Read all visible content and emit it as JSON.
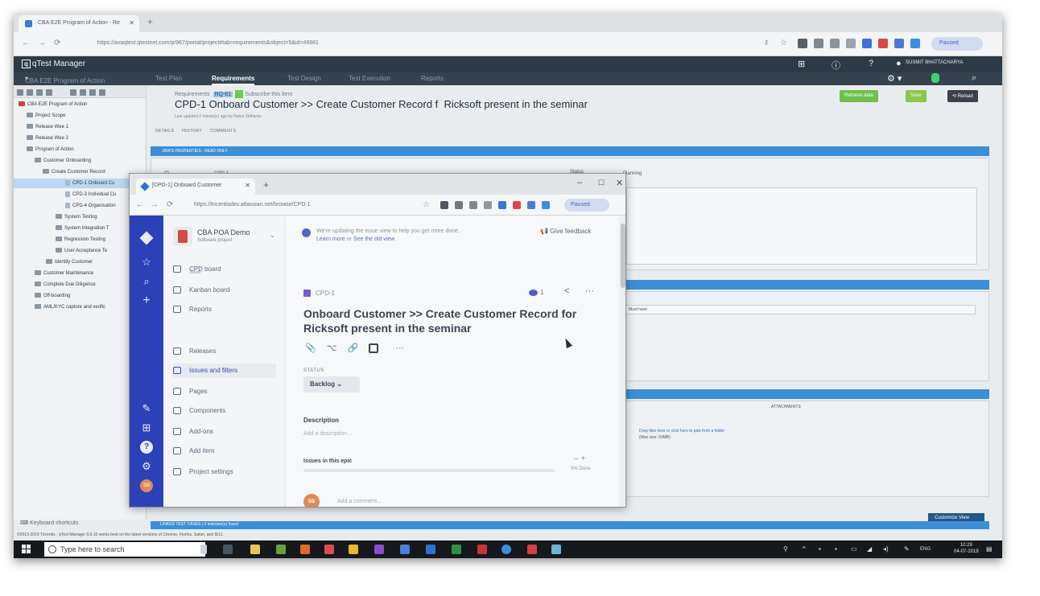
{
  "back_browser": {
    "tab_title": "CBA E2E Program of Action - Re",
    "url": "https://avaqtest.qtestnet.com/p/967/portal/project#tab=requirements&object=5&id=49981",
    "paused_label": "Paused"
  },
  "qtest": {
    "logo_text": "qTest Manager",
    "user_name": "SUSMIT BHATTACHARYA",
    "project_selector": "CBA E2E Program of Action",
    "nav_tabs": [
      "Test Plan",
      "Requirements",
      "Test Design",
      "Test Execution",
      "Reports"
    ],
    "tree": [
      "CBA E2E Program of Action",
      "Project Scope",
      "Release Wee 1",
      "Release Wee 2",
      "Program of Action",
      "Customer Onboarding",
      "Create Customer Record",
      "CPD-1 Onboard Cu",
      "CPD-3 Individual Cu",
      "CPD-4 Organisation",
      "System Testing",
      "System Integration T",
      "Regression Testing",
      "User Acceptance Te",
      "Identify Customer",
      "Customer Maintenance",
      "Complete Due Diligence",
      "Off-boarding",
      "AML/KYC capture and verific"
    ],
    "keyboard_shortcuts": "Keyboard shortcuts",
    "footnote": "©2013-2019 Tricentis · qTest Manager 9.6.10 works best on the latest versions of Chrome, Firefox, Safari, and IE11.",
    "breadcrumb": "Requirements",
    "req_id": "RQ-61",
    "subscribe_text": "Subscribe this item",
    "title": "CPD-1 Onboard Customer >> Create Customer Record f  Ricksoft present in the seminar",
    "last_updated": "Last updated 2 minute(s) ago by Rahul Sidhanta",
    "detail_tabs": [
      "DETAILS",
      "HISTORY",
      "COMMENTS"
    ],
    "buttons": {
      "retrieve": "Retrieve data",
      "save": "Save",
      "reload": "Reload"
    },
    "section_properties": "JIRA'S PROPERTIES - READ ONLY",
    "field_id": "ID",
    "field_id_value": "CPD-1",
    "field_status": "Status",
    "field_priority": "Planning",
    "select_value": "Must have",
    "attachments_label": "ATTACHMENTS",
    "drop_text": "Drag files here or click here to pick from a folder",
    "drop_size": "(Max size: 50MB)",
    "customize_view": "Customize View",
    "link_status": "LINKED TEST CASES | 0 testcase(s) found"
  },
  "jira_window": {
    "tab_title": "[CPD-1] Onboard Customer",
    "url": "https://tricentisdev.atlassian.net/browse/CPD-1",
    "paused_label": "Paused",
    "project_name": "CBA POA Demo",
    "project_type": "Software project",
    "sidebar": [
      {
        "label": "CPD board",
        "sub": "Board"
      },
      {
        "label": "Kanban board"
      },
      {
        "label": "Reports"
      },
      {
        "label": "Releases"
      },
      {
        "label": "Issues and filters"
      },
      {
        "label": "Pages"
      },
      {
        "label": "Components"
      },
      {
        "label": "Add-ons"
      },
      {
        "label": "Add item"
      },
      {
        "label": "Project settings"
      }
    ],
    "notice_line1": "We're updating the issue view to help you get more done.",
    "notice_learn": "Learn more",
    "notice_or": "or",
    "notice_old": "See the old view",
    "give_feedback": "Give feedback",
    "issue_key": "CPD-1",
    "watch_count": "1",
    "summary": "Onboard Customer >> Create Customer Record for Ricksoft present in the seminar",
    "status_label": "STATUS",
    "status_value": "Backlog",
    "description_heading": "Description",
    "description_placeholder": "Add a description...",
    "epic_heading": "Issues in this epic",
    "epic_progress_text": "0% Done",
    "epic_progress": 0,
    "avatar_initials": "SB",
    "comment_placeholder": "Add a comment..."
  },
  "taskbar": {
    "search_placeholder": "Type here to search",
    "language": "ENG",
    "time": "10:29",
    "date": "04-07-2019"
  },
  "colors": {
    "qtest_header": "#2d3a46",
    "jira_rail": "#2b41b7",
    "section_blue": "#3b8fd8",
    "save_green": "#6ec04a"
  }
}
